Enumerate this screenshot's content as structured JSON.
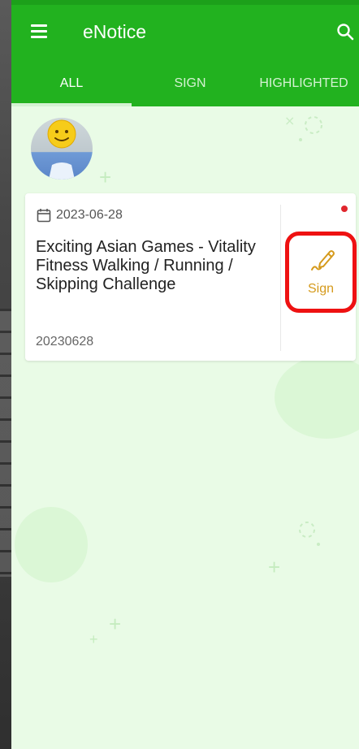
{
  "header": {
    "title": "eNotice",
    "tabs": [
      {
        "label": "ALL",
        "active": true
      },
      {
        "label": "SIGN",
        "active": false
      },
      {
        "label": "HIGHLIGHTED",
        "active": false
      }
    ]
  },
  "notices": [
    {
      "date": "2023-06-28",
      "title": "Exciting Asian Games - Vitality Fitness Walking / Running / Skipping Challenge",
      "code": "20230628",
      "unread": true,
      "action_label": "Sign"
    }
  ],
  "colors": {
    "primary": "#22b21f",
    "background": "#e9fbe6",
    "sign": "#d59a1c",
    "unread": "#e0262d",
    "highlight_outline": "#ee1111"
  },
  "icons": [
    "menu-icon",
    "search-icon",
    "calendar-icon",
    "pen-icon",
    "avatar-smiley"
  ]
}
